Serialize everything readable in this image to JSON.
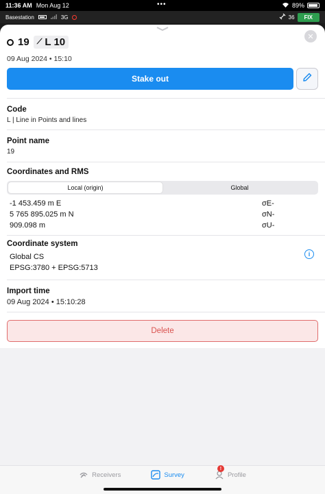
{
  "status": {
    "time": "11:36 AM",
    "date": "Mon Aug 12",
    "dots": "•••",
    "battery_pct": "89%"
  },
  "appbar": {
    "device": "Basestation",
    "network": "3G",
    "satellites": "36",
    "fix": "FIX"
  },
  "header": {
    "point_id": "19",
    "line_id": "L 10",
    "datetime": "09 Aug 2024 • 15:10"
  },
  "actions": {
    "stake_out": "Stake out",
    "delete": "Delete"
  },
  "code": {
    "label": "Code",
    "value": "L | Line in Points and lines"
  },
  "point_name": {
    "label": "Point name",
    "value": "19"
  },
  "coordinates": {
    "label": "Coordinates and RMS",
    "tabs": [
      "Local (origin)",
      "Global"
    ],
    "selected_tab": "Local (origin)",
    "rows": [
      {
        "value": "-1 453.459 m E",
        "rms": "σE-"
      },
      {
        "value": "5 765 895.025 m N",
        "rms": "σN-"
      },
      {
        "value": "909.098 m",
        "rms": "σU-"
      }
    ]
  },
  "coordinate_system": {
    "label": "Coordinate system",
    "name": "Global CS",
    "epsg": "EPSG:3780 + EPSG:5713"
  },
  "import_time": {
    "label": "Import time",
    "value": "09 Aug 2024 • 15:10:28"
  },
  "tabs": {
    "receivers": "Receivers",
    "survey": "Survey",
    "profile": "Profile",
    "profile_badge": "!"
  },
  "colors": {
    "accent": "#1a8cf0",
    "fix_green": "#2e9e4f",
    "delete_red": "#d9534f"
  }
}
